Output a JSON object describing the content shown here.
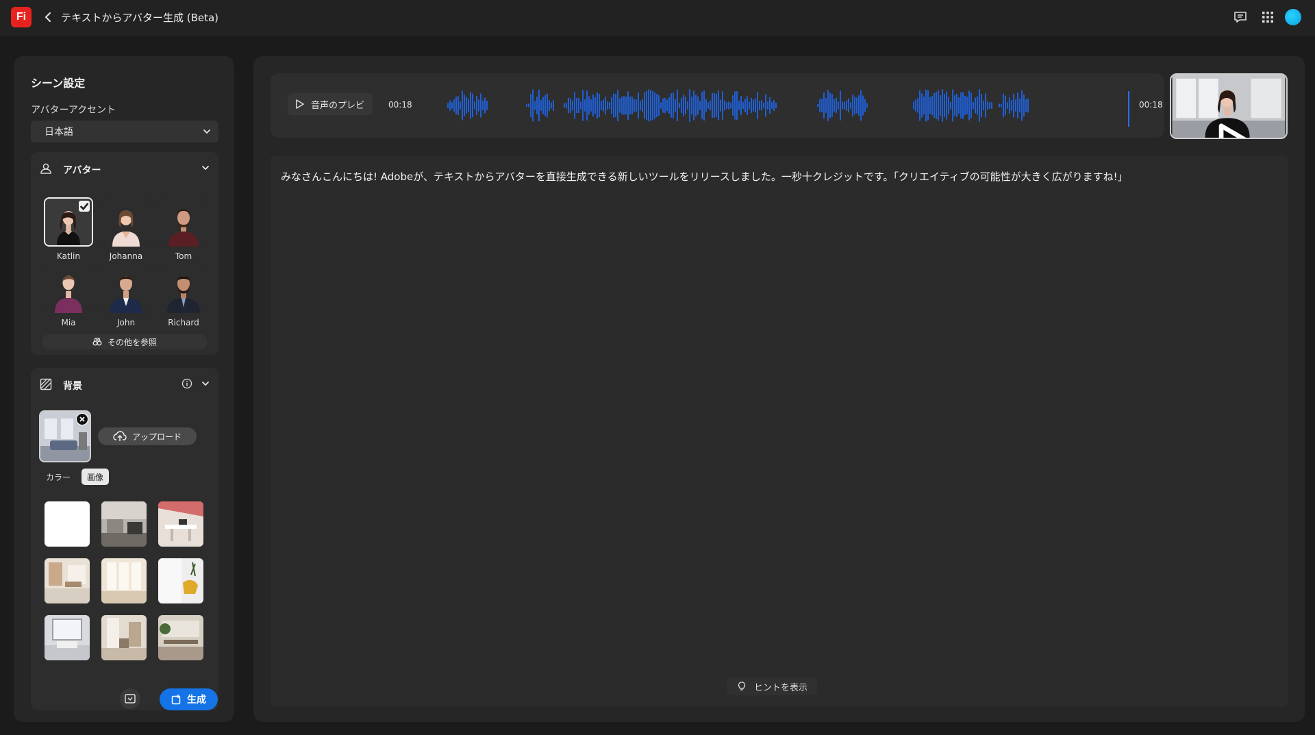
{
  "topbar": {
    "logo_text": "Fi",
    "title": "テキストからアバター生成 (Beta)",
    "icons": [
      "back-chevron-icon",
      "comment-icon",
      "apps-grid-icon",
      "user-avatar"
    ]
  },
  "scene": {
    "title": "シーン設定",
    "accent_label": "アバターアクセント",
    "accent_value": "日本語"
  },
  "avatar_section": {
    "label": "アバター",
    "avatars": [
      {
        "name": "Katlin",
        "selected": true
      },
      {
        "name": "Johanna",
        "selected": false
      },
      {
        "name": "Tom",
        "selected": false
      },
      {
        "name": "Mia",
        "selected": false
      },
      {
        "name": "John",
        "selected": false
      },
      {
        "name": "Richard",
        "selected": false
      }
    ],
    "see_more": "その他を参照"
  },
  "background_section": {
    "label": "背景",
    "upload_label": "アップロード",
    "tab_color": "カラー",
    "tab_image": "画像",
    "selected_tab": "画像"
  },
  "actions": {
    "generate_label": "生成"
  },
  "audio": {
    "preview_label": "音声のプレビ",
    "time_start": "00:18",
    "time_end": "00:18"
  },
  "script": {
    "text": "みなさんこんにちは! Adobeが、テキストからアバターを直接生成できる新しいツールをリリースしました。一秒十クレジットです。「クリエイティブの可能性が大きく広がりますね!」"
  },
  "hint": {
    "label": "ヒントを表示"
  },
  "colors": {
    "accent": "#1473e6",
    "waveform": "#1f5fd6",
    "logo": "#e8231f"
  }
}
